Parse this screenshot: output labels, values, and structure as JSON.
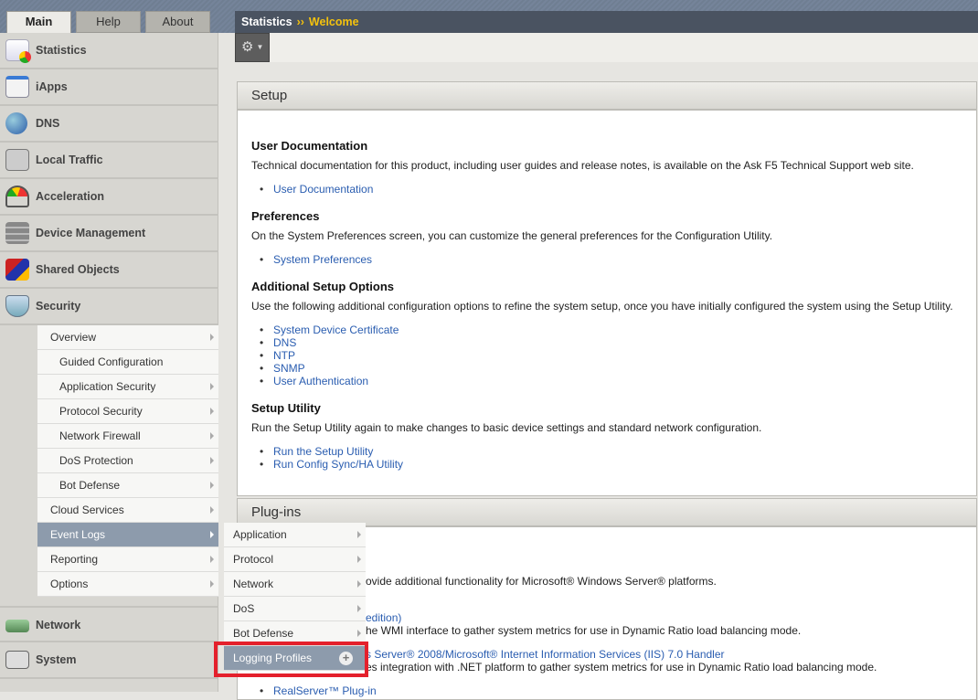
{
  "tabs": [
    "Main",
    "Help",
    "About"
  ],
  "breadcrumb": {
    "section": "Statistics",
    "separator": "››",
    "current": "Welcome"
  },
  "nav": [
    "Statistics",
    "iApps",
    "DNS",
    "Local Traffic",
    "Acceleration",
    "Device Management",
    "Shared Objects",
    "Security",
    "Network",
    "System"
  ],
  "security_submenu": [
    "Overview",
    "Guided Configuration",
    "Application Security",
    "Protocol Security",
    "Network Firewall",
    "DoS Protection",
    "Bot Defense",
    "Cloud Services",
    "Event Logs",
    "Reporting",
    "Options"
  ],
  "event_logs_flyout": [
    "Application",
    "Protocol",
    "Network",
    "DoS",
    "Bot Defense",
    "Logging Profiles"
  ],
  "setup": {
    "title": "Setup",
    "user_doc_h": "User Documentation",
    "user_doc_p": "Technical documentation for this product, including user guides and release notes, is available on the Ask F5 Technical Support web site.",
    "user_doc_link": "User Documentation",
    "pref_h": "Preferences",
    "pref_p": "On the System Preferences screen, you can customize the general preferences for the Configuration Utility.",
    "pref_link": "System Preferences",
    "add_h": "Additional Setup Options",
    "add_p": "Use the following additional configuration options to refine the system setup, once you have initially configured the system using the Setup Utility.",
    "add_links": [
      "System Device Certificate",
      "DNS",
      "NTP",
      "SNMP",
      "User Authentication"
    ],
    "util_h": "Setup Utility",
    "util_p": "Run the Setup Utility again to make changes to basic device settings and standard network configuration.",
    "util_links": [
      "Run the Setup Utility",
      "Run Config Sync/HA Utility"
    ]
  },
  "plugins": {
    "title": "Plug-ins",
    "frag1": "ovide additional functionality for Microsoft® Windows Server® platforms.",
    "frag2": "edition)",
    "frag3": "he WMI interface to gather system metrics for use in Dynamic Ratio load balancing mode.",
    "frag4": "s Server® 2008/Microsoft® Internet Information Services (IIS) 7.0 Handler",
    "frag5": "es integration with .NET platform to gather system metrics for use in Dynamic Ratio load balancing mode.",
    "link_last": "RealServer™ Plug-in"
  }
}
